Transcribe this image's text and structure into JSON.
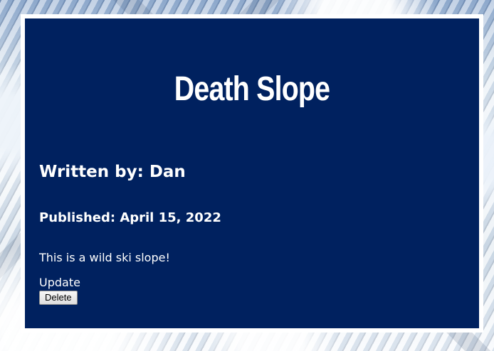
{
  "post": {
    "title": "Death Slope",
    "author_line": "Written by: Dan",
    "published_line": "Published: April 15, 2022",
    "body": "This is a wild ski slope!"
  },
  "actions": {
    "update_label": "Update",
    "delete_label": "Delete"
  },
  "colors": {
    "card_background": "#00215f",
    "card_border": "#ffffff",
    "text": "#ffffff"
  }
}
